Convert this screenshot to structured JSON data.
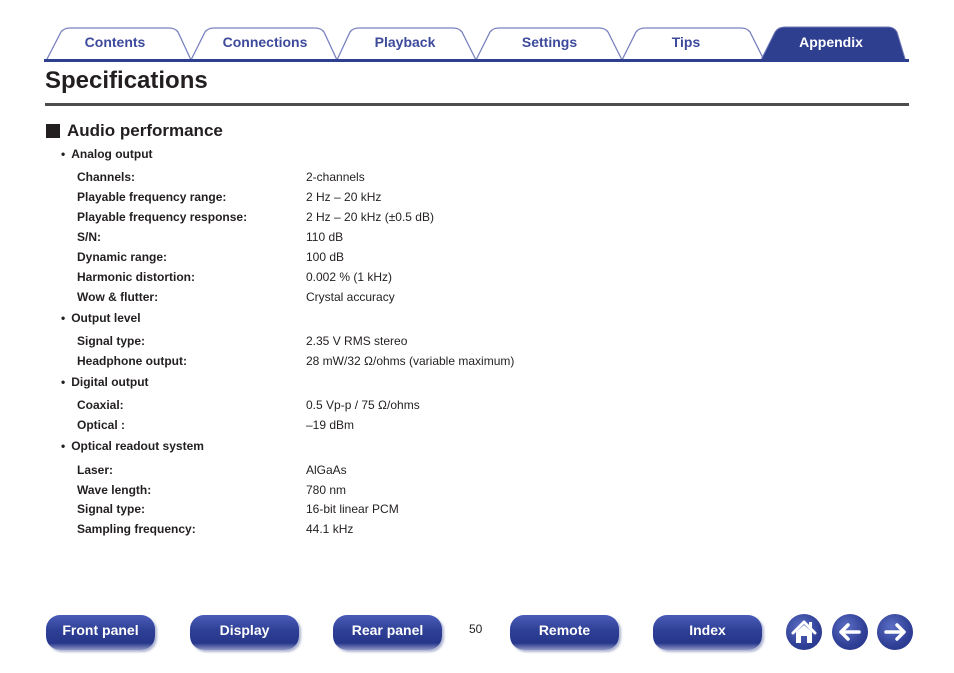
{
  "tabs": [
    {
      "label": "Contents",
      "active": false
    },
    {
      "label": "Connections",
      "active": false
    },
    {
      "label": "Playback",
      "active": false
    },
    {
      "label": "Settings",
      "active": false
    },
    {
      "label": "Tips",
      "active": false
    },
    {
      "label": "Appendix",
      "active": true
    }
  ],
  "page": {
    "title": "Specifications",
    "section_heading": "Audio performance",
    "page_number": "50"
  },
  "groups": [
    {
      "label": "Analog output",
      "rows": [
        {
          "key": "Channels:",
          "value": "2-channels"
        },
        {
          "key": "Playable frequency range:",
          "value": "2 Hz – 20 kHz"
        },
        {
          "key": "Playable frequency response:",
          "value": "2 Hz – 20 kHz (±0.5 dB)"
        },
        {
          "key": "S/N:",
          "value": "110 dB"
        },
        {
          "key": "Dynamic range:",
          "value": "100 dB"
        },
        {
          "key": "Harmonic distortion:",
          "value": "0.002 % (1 kHz)"
        },
        {
          "key": "Wow & flutter:",
          "value": "Crystal accuracy"
        }
      ]
    },
    {
      "label": "Output level",
      "rows": [
        {
          "key": "Signal type:",
          "value": "2.35 V RMS stereo"
        },
        {
          "key": "Headphone output:",
          "value": "28 mW/32 Ω/ohms (variable maximum)"
        }
      ]
    },
    {
      "label": "Digital output",
      "rows": [
        {
          "key": "Coaxial:",
          "value": "0.5 Vp-p / 75 Ω/ohms"
        },
        {
          "key": "Optical :",
          "value": "–19 dBm"
        }
      ]
    },
    {
      "label": "Optical readout system",
      "rows": [
        {
          "key": "Laser:",
          "value": "AlGaAs"
        },
        {
          "key": "Wave length:",
          "value": "780 nm"
        },
        {
          "key": "Signal type:",
          "value": "16-bit linear PCM"
        },
        {
          "key": "Sampling frequency:",
          "value": "44.1 kHz"
        }
      ]
    }
  ],
  "footer": {
    "buttons": [
      {
        "label": "Front panel"
      },
      {
        "label": "Display"
      },
      {
        "label": "Rear panel"
      },
      {
        "label": "Remote"
      },
      {
        "label": "Index"
      }
    ],
    "icons": [
      {
        "name": "home-icon"
      },
      {
        "name": "back-arrow-icon"
      },
      {
        "name": "forward-arrow-icon"
      }
    ]
  },
  "colors": {
    "accent": "#2f3f8f",
    "tab_text": "#3d4a9c",
    "tab_outline": "#7b82c0",
    "text": "#231f20"
  },
  "bullet": "•"
}
